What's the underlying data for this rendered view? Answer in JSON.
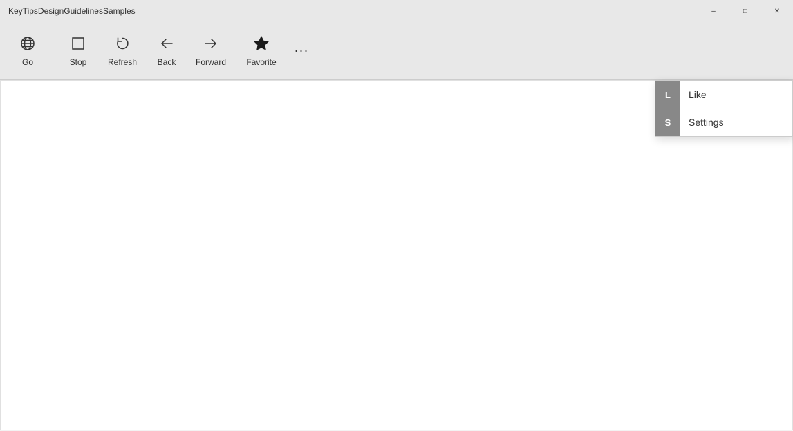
{
  "titleBar": {
    "title": "KeyTipsDesignGuidelinesSamples",
    "controls": {
      "minimize": "–",
      "maximize": "□",
      "close": "✕"
    }
  },
  "toolbar": {
    "buttons": [
      {
        "id": "go",
        "label": "Go",
        "icon": "globe"
      },
      {
        "id": "stop",
        "label": "Stop",
        "icon": "square"
      },
      {
        "id": "refresh",
        "label": "Refresh",
        "icon": "refresh"
      },
      {
        "id": "back",
        "label": "Back",
        "icon": "back"
      },
      {
        "id": "forward",
        "label": "Forward",
        "icon": "forward"
      },
      {
        "id": "favorite",
        "label": "Favorite",
        "icon": "star"
      }
    ],
    "moreButton": "···"
  },
  "dropdown": {
    "items": [
      {
        "id": "like",
        "label": "Like",
        "keytip": "L"
      },
      {
        "id": "settings",
        "label": "Settings",
        "keytip": "S"
      }
    ]
  }
}
